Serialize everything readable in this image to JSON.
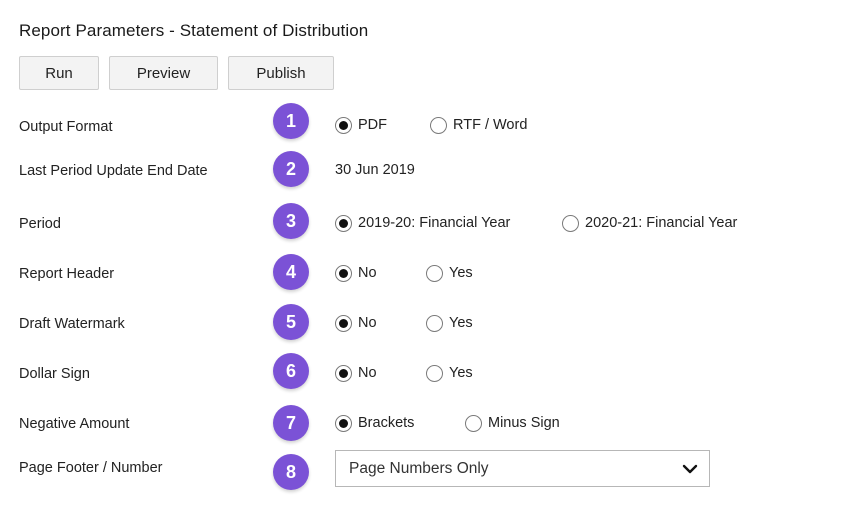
{
  "page": {
    "title": "Report Parameters - Statement of Distribution"
  },
  "toolbar": {
    "run": "Run",
    "preview": "Preview",
    "publish": "Publish"
  },
  "accent_color": "#7b52d6",
  "params": [
    {
      "label": "Output Format",
      "step": "1",
      "options": [
        "PDF",
        "RTF / Word"
      ],
      "selected": 0
    },
    {
      "label": "Last Period Update End Date",
      "step": "2",
      "value": "30 Jun 2019"
    },
    {
      "label": "Period",
      "step": "3",
      "options": [
        "2019-20: Financial Year",
        "2020-21: Financial Year"
      ],
      "selected": 0
    },
    {
      "label": "Report Header",
      "step": "4",
      "options": [
        "No",
        "Yes"
      ],
      "selected": 0
    },
    {
      "label": "Draft Watermark",
      "step": "5",
      "options": [
        "No",
        "Yes"
      ],
      "selected": 0
    },
    {
      "label": "Dollar Sign",
      "step": "6",
      "options": [
        "No",
        "Yes"
      ],
      "selected": 0
    },
    {
      "label": "Negative Amount",
      "step": "7",
      "options": [
        "Brackets",
        "Minus Sign"
      ],
      "selected": 0
    },
    {
      "label": "Page Footer / Number",
      "step": "8",
      "select_value": "Page Numbers Only"
    }
  ]
}
